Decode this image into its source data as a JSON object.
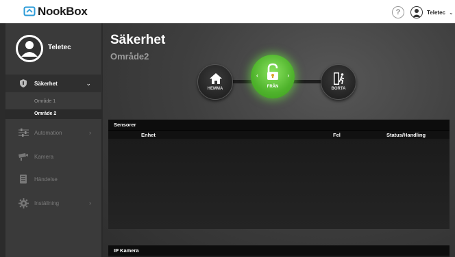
{
  "topbar": {
    "logo_text": "NookBox",
    "help_label": "?",
    "user_name": "Teletec",
    "user_caret": "⌄"
  },
  "sidebar": {
    "profile_name": "Teletec",
    "items": [
      {
        "label": "Säkerhet",
        "icon": "shield-icon",
        "arrow": "⌄",
        "active": true
      },
      {
        "label": "Automation",
        "icon": "sliders-icon",
        "arrow": "›",
        "active": false
      },
      {
        "label": "Kamera",
        "icon": "camera-icon",
        "arrow": "",
        "active": false
      },
      {
        "label": "Händelse",
        "icon": "event-log-icon",
        "arrow": "",
        "active": false
      },
      {
        "label": "Inställning",
        "icon": "gear-icon",
        "arrow": "›",
        "active": false
      }
    ],
    "subitems": [
      {
        "label": "Område 1",
        "active": false
      },
      {
        "label": "Område 2",
        "active": true
      }
    ]
  },
  "main": {
    "title": "Säkerhet",
    "subtitle": "Område2",
    "modes": {
      "home_label": "HEMMA",
      "off_label": "FRÅN",
      "away_label": "BORTA",
      "left_arrow": "‹",
      "right_arrow": "›"
    },
    "sensors": {
      "title": "Sensorer",
      "columns": [
        "Enhet",
        "Fel",
        "Status/Handling"
      ]
    },
    "ip_camera": {
      "title": "IP Kamera"
    }
  },
  "colors": {
    "accent_green": "#5cc436",
    "sidebar_bg": "#3a3a3a",
    "header_bg": "#ffffff"
  }
}
